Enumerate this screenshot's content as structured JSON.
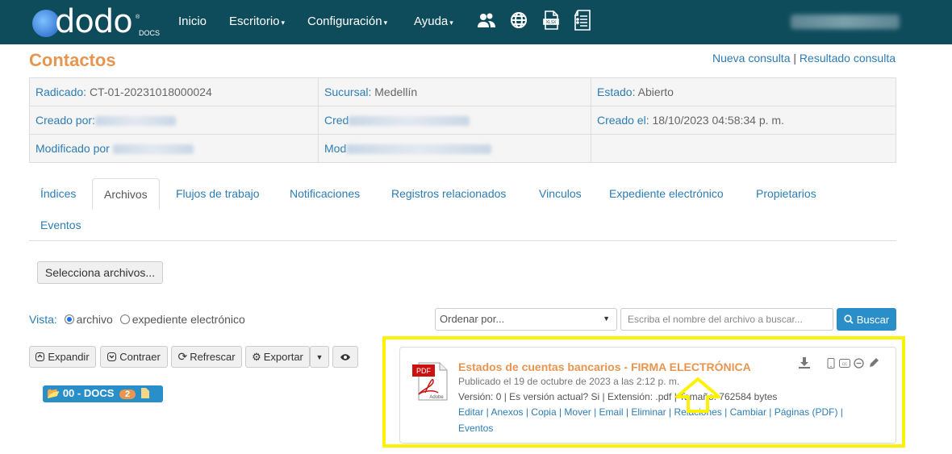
{
  "nav": {
    "brand": "dodo",
    "brand_sub": "DOCS",
    "inicio": "Inicio",
    "escritorio": "Escritorio",
    "configuracion": "Configuración",
    "ayuda": "Ayuda",
    "caret": "▾"
  },
  "page": {
    "title": "Contactos",
    "nueva_consulta": "Nueva consulta",
    "sep": "|",
    "resultado_consulta": "Resultado consulta"
  },
  "info": {
    "radicado_lbl": "Radicado:",
    "radicado_val": "CT-01-20231018000024",
    "sucursal_lbl": "Sucursal:",
    "sucursal_val": "Medellín",
    "estado_lbl": "Estado:",
    "estado_val": "Abierto",
    "creado_por_lbl": "Creado por:",
    "cred_lbl": "Cred",
    "creado_el_lbl": "Creado el:",
    "creado_el_val": "18/10/2023 04:58:34 p. m.",
    "modificado_por_lbl": "Modificado por",
    "mod_lbl": "Mod"
  },
  "tabs": [
    "Índices",
    "Archivos",
    "Flujos de trabajo",
    "Notificaciones",
    "Registros relacionados",
    "Vinculos",
    "Expediente electrónico",
    "Propietarios",
    "Eventos"
  ],
  "upload_label": "Selecciona archivos...",
  "vista": {
    "label": "Vista:",
    "opt1": "archivo",
    "opt2": "expediente electrónico"
  },
  "order": {
    "value": "Ordenar por...",
    "arrow": "▼"
  },
  "search": {
    "placeholder": "Escriba el nombre del archivo a buscar...",
    "button": "Buscar"
  },
  "toolbar": {
    "expandir": "Expandir",
    "contraer": "Contraer",
    "refrescar": "Refrescar",
    "exportar": "Exportar"
  },
  "folder": {
    "name": "00 - DOCS",
    "count": "2"
  },
  "file": {
    "title": "Estados de cuentas bancarios - FIRMA ELECTRÓNICA",
    "published": "Publicado el 19 de octubre de 2023 a las 2:12 p. m.",
    "meta": "Versión: 0 | Es versión actual? Si | Extensión: .pdf | Tamaño: 762584 bytes",
    "links1": "Editar | Anexos | Copia | Mover | Email | Eliminar | Relaciones | Cambiar | Páginas (PDF) |",
    "links2": "Eventos",
    "pdf_label": "PDF",
    "adobe_label": "Adobe"
  },
  "colors": {
    "topbar": "#0e4c5c",
    "accent": "#e8954f",
    "link": "#2c7cb5",
    "primary": "#2a8fc9",
    "highlight": "#fff200"
  }
}
